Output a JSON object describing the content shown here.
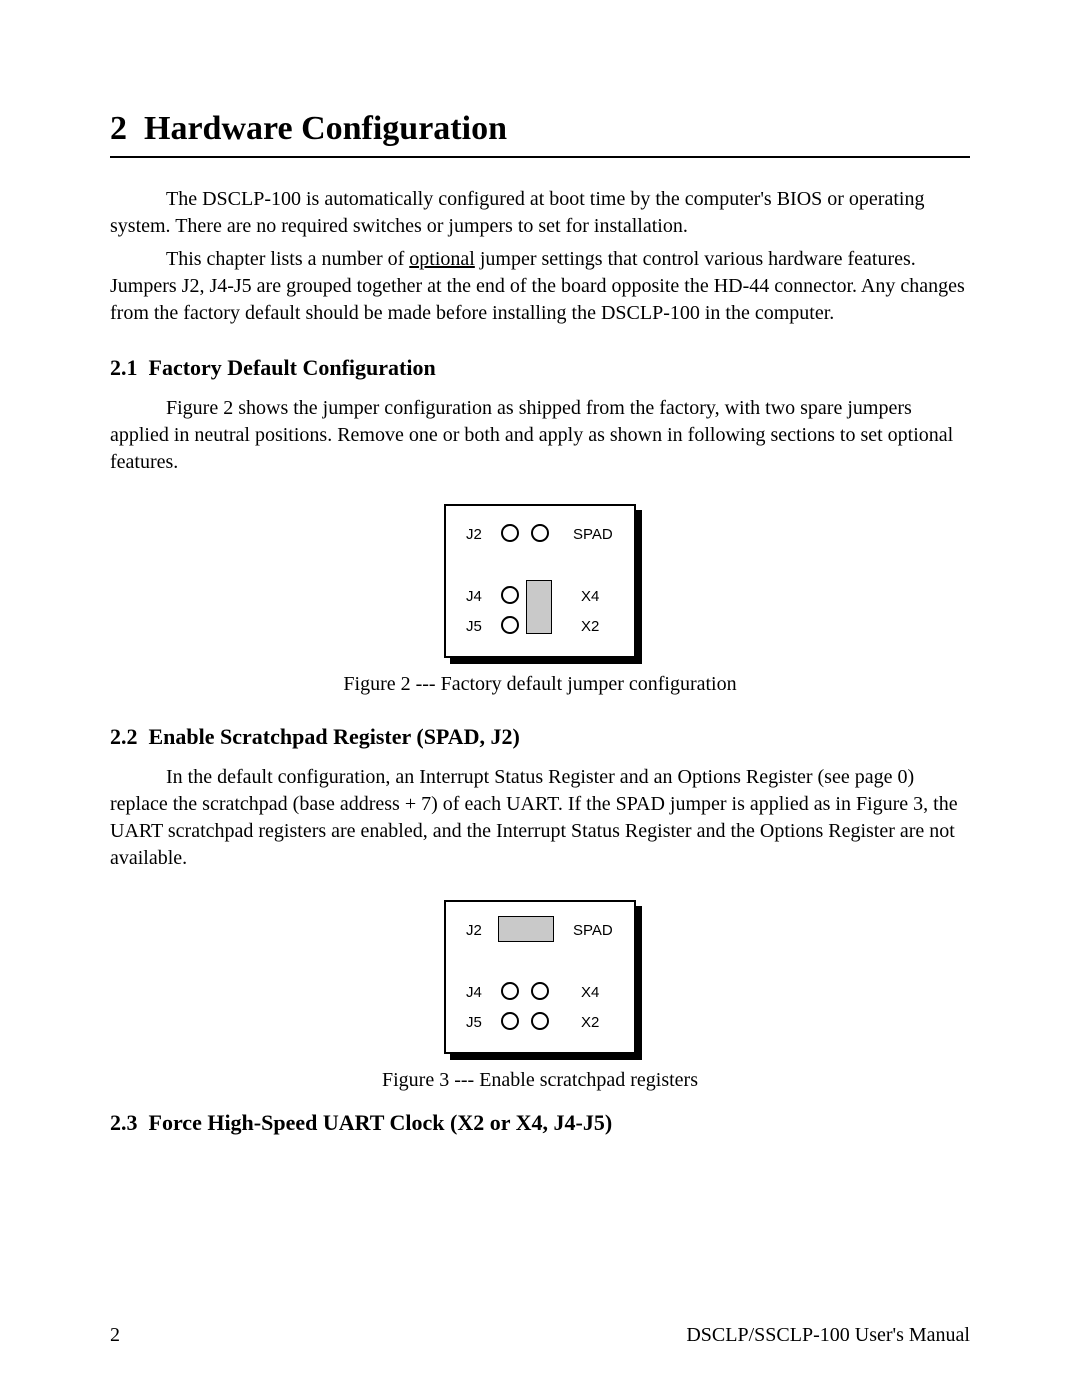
{
  "chapter": {
    "number": "2",
    "title": "Hardware Configuration"
  },
  "para1": "The DSCLP-100 is automatically configured at boot time by the computer's BIOS or operating system.  There are no required switches or jumpers to set for installation.",
  "para2a": "This chapter lists a number of ",
  "para2_opt": "optional",
  "para2b": " jumper settings that control various hardware features.  Jumpers J2, J4-J5 are grouped together at the end of the board opposite the HD-44 connector.  Any changes from the factory default should be made before installing the DSCLP-100 in the computer.",
  "sec21": {
    "num": "2.1",
    "title": "Factory Default Configuration",
    "para": "Figure 2 shows the jumper configuration as shipped from the factory, with two spare jumpers applied in neutral positions.  Remove one or both and apply as shown in following sections to set optional features."
  },
  "fig2_caption": "Figure 2 --- Factory default jumper configuration",
  "sec22": {
    "num": "2.2",
    "title": "Enable Scratchpad Register (SPAD, J2)",
    "para": "In the default configuration, an Interrupt Status Register and an Options Register (see page 0) replace the scratchpad (base address + 7) of each UART.   If the SPAD jumper is applied as in Figure 3, the UART scratchpad registers are enabled, and the Interrupt Status Register and the Options Register are not available."
  },
  "fig3_caption": "Figure 3 --- Enable scratchpad registers",
  "sec23": {
    "num": "2.3",
    "title": "Force High-Speed UART Clock (X2 or X4, J4-J5)"
  },
  "jumper_labels": {
    "J2": "J2",
    "J4": "J4",
    "J5": "J5",
    "SPAD": "SPAD",
    "X4": "X4",
    "X2": "X2"
  },
  "footer": {
    "page": "2",
    "manual": "DSCLP/SSCLP-100 User's Manual"
  }
}
